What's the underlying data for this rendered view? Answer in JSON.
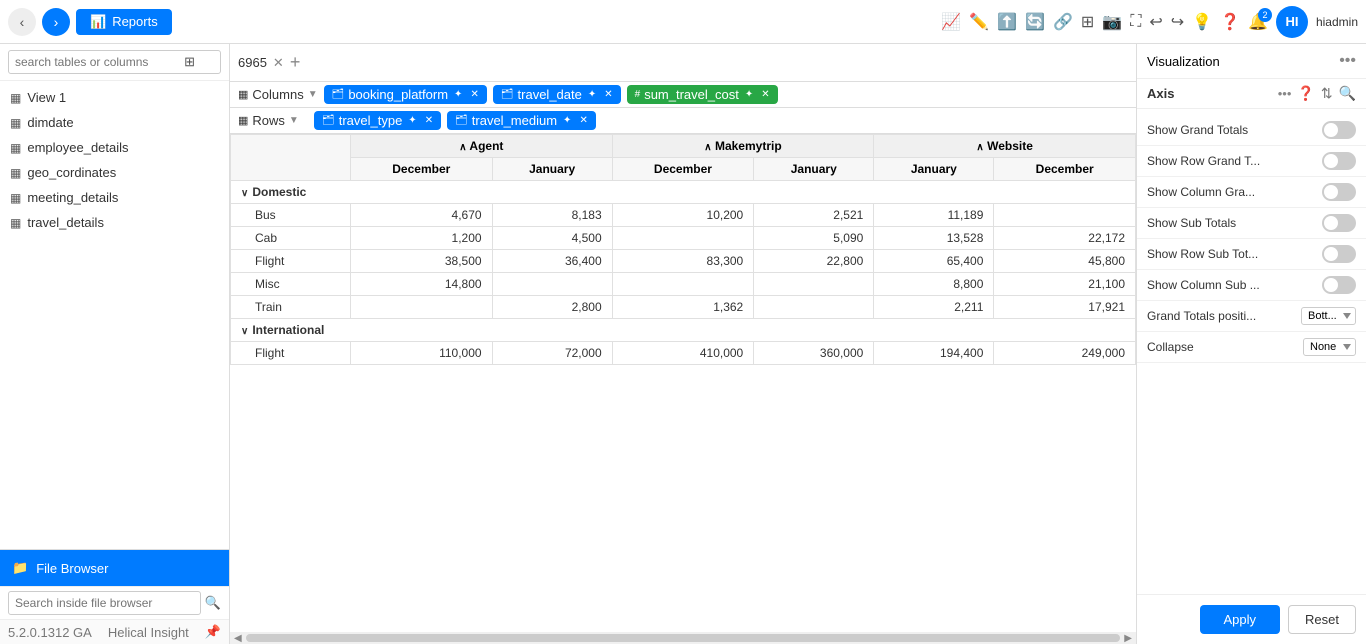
{
  "topnav": {
    "tab_number": "6965",
    "reports_label": "Reports",
    "user_initials": "HI",
    "username": "hiadmin",
    "notif_count": "2"
  },
  "sidebar": {
    "search_placeholder": "search tables or columns",
    "items": [
      {
        "label": "View 1",
        "icon": "▦",
        "type": "view"
      },
      {
        "label": "dimdate",
        "icon": "▦",
        "type": "table"
      },
      {
        "label": "employee_details",
        "icon": "▦",
        "type": "table"
      },
      {
        "label": "geo_cordinates",
        "icon": "▦",
        "type": "table"
      },
      {
        "label": "meeting_details",
        "icon": "▦",
        "type": "table"
      },
      {
        "label": "travel_details",
        "icon": "▦",
        "type": "table"
      }
    ],
    "file_browser_label": "File Browser",
    "file_search_placeholder": "Search inside file browser",
    "footer_version": "5.2.0.1312 GA",
    "footer_brand": "Helical Insight"
  },
  "pivot": {
    "columns_label": "Columns",
    "rows_label": "Rows",
    "columns_chips": [
      {
        "label": "booking_platform",
        "color": "blue"
      },
      {
        "label": "travel_date",
        "color": "blue"
      },
      {
        "label": "sum_travel_cost",
        "color": "green"
      }
    ],
    "rows_chips": [
      {
        "label": "travel_type",
        "color": "blue"
      },
      {
        "label": "travel_medium",
        "color": "blue"
      }
    ]
  },
  "table": {
    "col_groups": [
      "Agent",
      "Makemytrip",
      "Website"
    ],
    "sub_cols": {
      "Agent": [
        "December",
        "January"
      ],
      "Makemytrip": [
        "December",
        "January"
      ],
      "Website": [
        "January",
        "December"
      ]
    },
    "rows": [
      {
        "group": "Domestic",
        "children": [
          {
            "label": "Bus",
            "values": [
              4670,
              8183,
              10200,
              2521,
              11189,
              ""
            ]
          },
          {
            "label": "Cab",
            "values": [
              1200,
              4500,
              "",
              5090,
              13528,
              22172
            ]
          },
          {
            "label": "Flight",
            "values": [
              38500,
              36400,
              83300,
              22800,
              65400,
              45800
            ]
          },
          {
            "label": "Misc",
            "values": [
              14800,
              "",
              "",
              "",
              8800,
              21100
            ]
          },
          {
            "label": "Train",
            "values": [
              "",
              2800,
              1362,
              "",
              2211,
              17921
            ]
          }
        ]
      },
      {
        "group": "International",
        "children": [
          {
            "label": "Flight",
            "values": [
              110000,
              72000,
              410000,
              360000,
              194400,
              249000
            ]
          }
        ]
      }
    ]
  },
  "right_panel": {
    "title": "Visualization",
    "axis_label": "Axis",
    "options": [
      {
        "label": "Show Grand Totals",
        "type": "toggle",
        "state": "off"
      },
      {
        "label": "Show Row Grand T...",
        "type": "toggle",
        "state": "off"
      },
      {
        "label": "Show Column Gra...",
        "type": "toggle",
        "state": "off"
      },
      {
        "label": "Show Sub Totals",
        "type": "toggle",
        "state": "off"
      },
      {
        "label": "Show Row Sub Tot...",
        "type": "toggle",
        "state": "off"
      },
      {
        "label": "Show Column Sub ...",
        "type": "toggle",
        "state": "off"
      },
      {
        "label": "Grand Totals positi...",
        "type": "select",
        "value": "Bott..."
      },
      {
        "label": "Collapse",
        "type": "select",
        "value": "None"
      }
    ],
    "apply_label": "Apply",
    "reset_label": "Reset"
  }
}
